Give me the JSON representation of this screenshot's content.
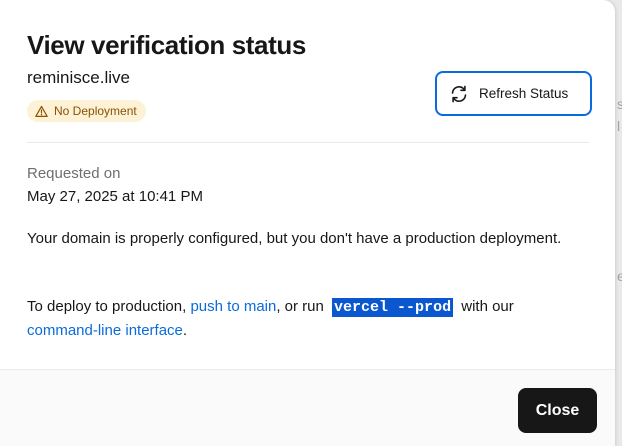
{
  "modal": {
    "title": "View verification status",
    "domain": "reminisce.live",
    "badge": "No Deployment",
    "refresh_label": "Refresh Status",
    "requested_label": "Requested on",
    "requested_date": "May 27, 2025 at 10:41 PM",
    "message": "Your domain is properly configured, but you don't have a production deployment.",
    "deploy": {
      "prefix": "To deploy to production, ",
      "push_link": "push to main",
      "middle": ", or run",
      "command": "vercel --prod",
      "after_command": "with our",
      "cli_link": "command-line interface",
      "end": "."
    },
    "close_label": "Close"
  },
  "colors": {
    "accent": "#0a6bdc",
    "badge_bg": "#fdf1d6",
    "badge_text": "#8a5200",
    "close_bg": "#171717",
    "highlight": "#0b57d0"
  },
  "icons": {
    "badge": "warning-icon",
    "refresh": "refresh-icon"
  }
}
